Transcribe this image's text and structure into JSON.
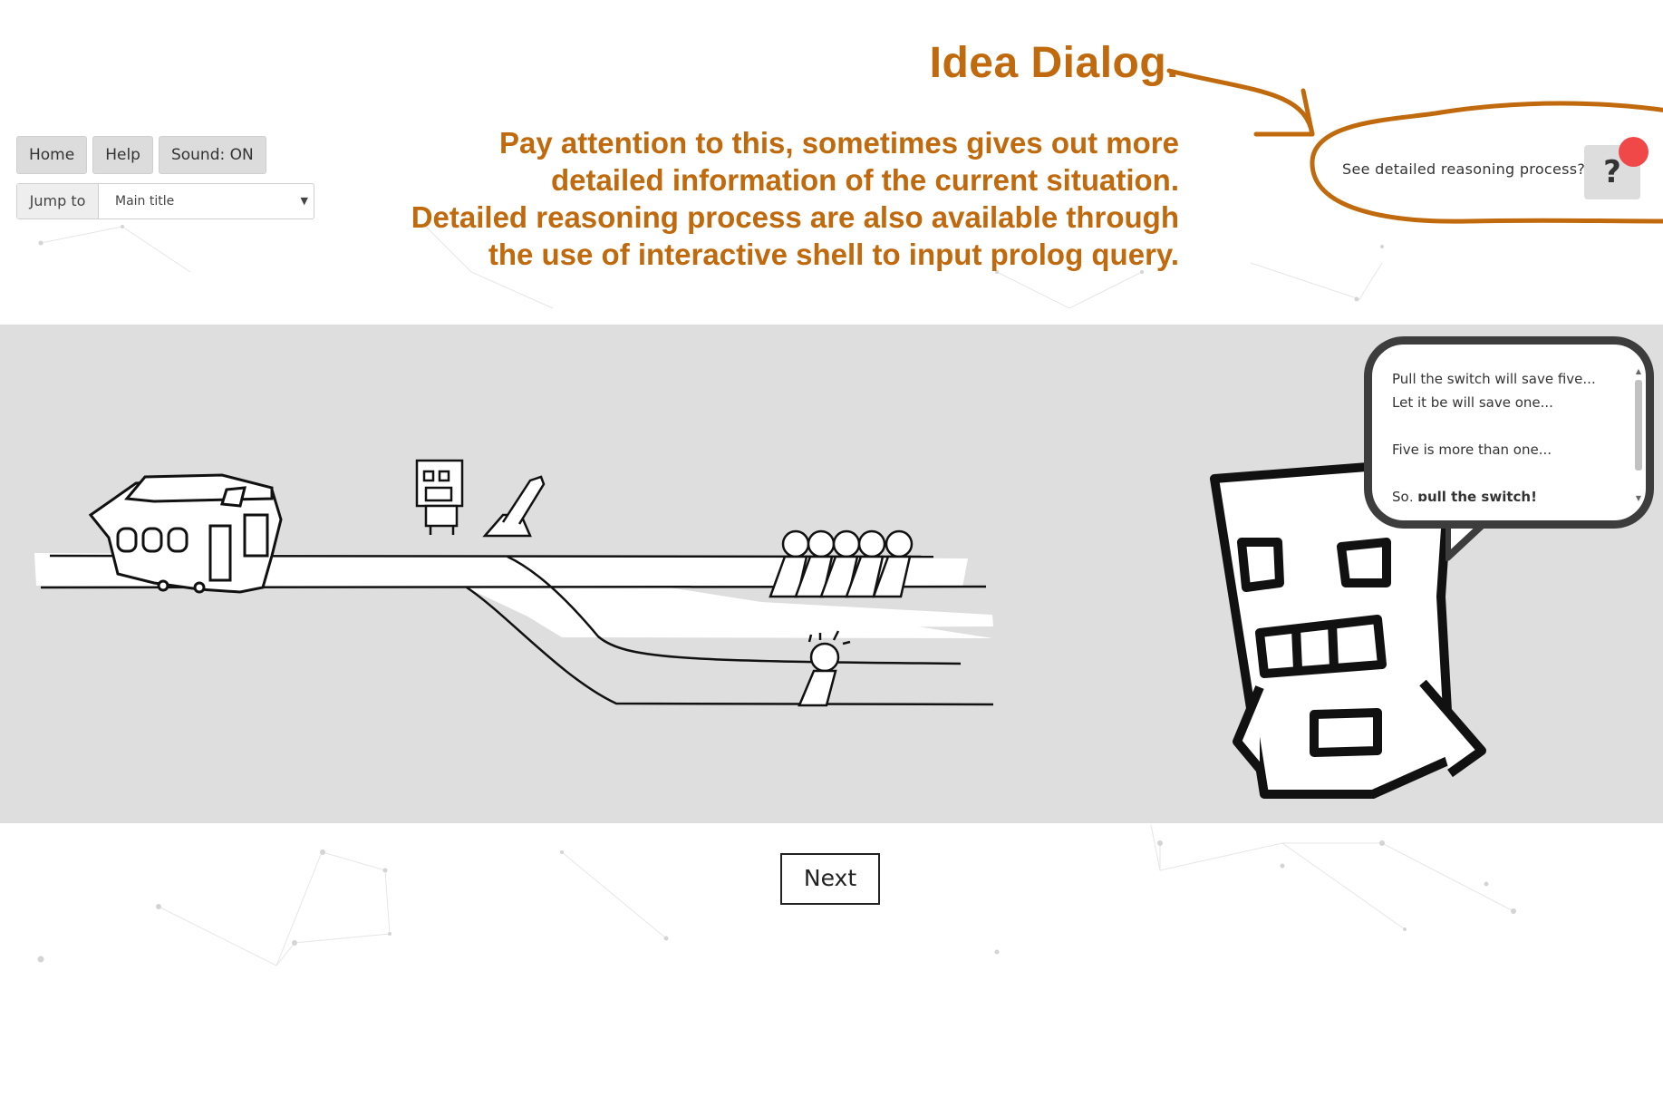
{
  "toolbar": {
    "home_label": "Home",
    "help_label": "Help",
    "sound_label": "Sound: ON",
    "jump_label": "Jump to",
    "jump_selected": "Main title"
  },
  "annotation": {
    "title": "Idea Dialog.",
    "lines": [
      "Pay attention to this, sometimes gives out more",
      "detailed  information of the current situation.",
      "Detailed reasoning process are also available through",
      "the use of interactive shell to input prolog query."
    ],
    "color": "#c0690d"
  },
  "idea_dialog": {
    "text": "See detailed reasoning process?",
    "button_label": "?",
    "badge_color": "#f04848"
  },
  "speech_bubble": {
    "lines": [
      "Pull the switch will save five...",
      "Let it be will save one...",
      "Five is more than one...",
      "So, "
    ],
    "emphasis": "pull the switch!"
  },
  "next_label": "Next"
}
